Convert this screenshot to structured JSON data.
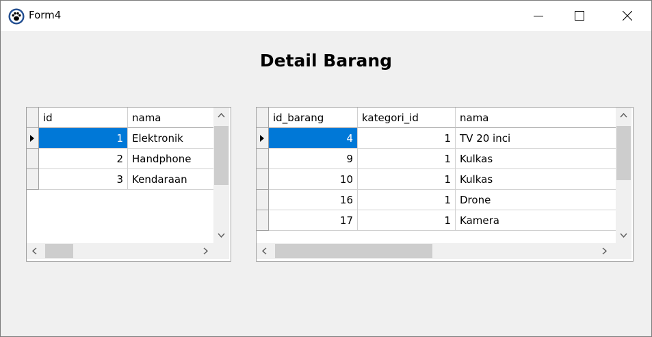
{
  "window": {
    "title": "Form4"
  },
  "heading": "Detail Barang",
  "grid_kategori": {
    "columns": [
      "id",
      "nama"
    ],
    "rows": [
      [
        "1",
        "Elektronik"
      ],
      [
        "2",
        "Handphone"
      ],
      [
        "3",
        "Kendaraan"
      ]
    ],
    "selected_row": 0
  },
  "grid_barang": {
    "columns": [
      "id_barang",
      "kategori_id",
      "nama"
    ],
    "rows": [
      [
        "4",
        "1",
        "TV 20 inci"
      ],
      [
        "9",
        "1",
        "Kulkas"
      ],
      [
        "10",
        "1",
        "Kulkas"
      ],
      [
        "16",
        "1",
        "Drone"
      ],
      [
        "17",
        "1",
        "Kamera"
      ]
    ],
    "selected_row": 0
  },
  "colors": {
    "selection": "#0078d7",
    "window_bg": "#f0f0f0"
  },
  "icons": [
    "paw-app-icon",
    "minimize-icon",
    "maximize-icon",
    "close-icon",
    "scroll-up-icon",
    "scroll-down-icon",
    "scroll-left-icon",
    "scroll-right-icon",
    "row-pointer-icon"
  ]
}
